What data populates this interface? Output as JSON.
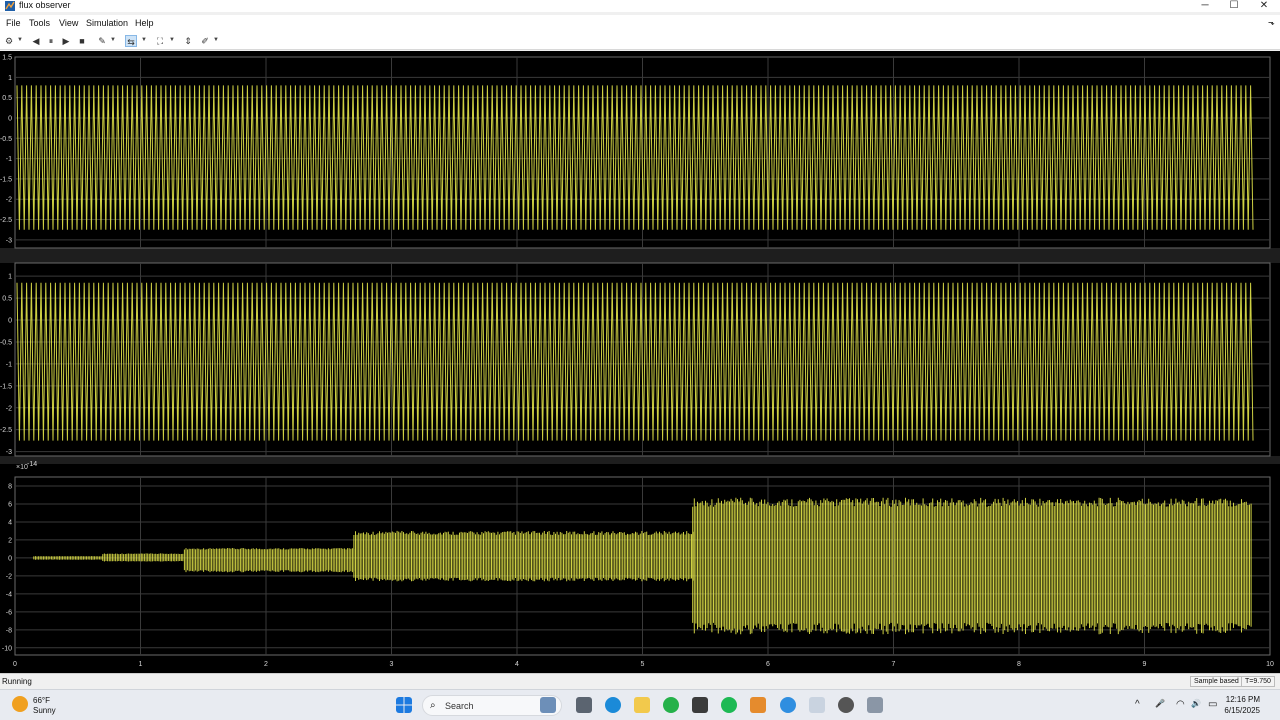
{
  "window": {
    "title": "flux observer"
  },
  "window_controls": {
    "minimize": "─",
    "maximize": "☐",
    "close": "✕"
  },
  "menu": {
    "items": [
      "File",
      "Tools",
      "View",
      "Simulation",
      "Help"
    ],
    "overflow": "⬎"
  },
  "toolbar": {
    "settings_icon": "⚙",
    "step_back_icon": "◀",
    "pause_icon": "⏸",
    "play_icon": "▶",
    "stop_icon": "■",
    "highlight_icon": "✎",
    "cursor_icon": "⇆",
    "zoom_icon": "⛶",
    "autoscale_icon": "⇕",
    "style_icon": "✐",
    "dropdown": "▼"
  },
  "plots": [
    {
      "y_ticks": [
        "1.5",
        "1",
        "0.5",
        "0",
        "-0.5",
        "-1",
        "-1.5",
        "-2",
        "-2.5",
        "-3"
      ]
    },
    {
      "y_ticks": [
        "1",
        "0.5",
        "0",
        "-0.5",
        "-1",
        "-1.5",
        "-2",
        "-2.5",
        "-3"
      ]
    },
    {
      "exponent": "×10",
      "exponent_power": "-14",
      "y_ticks": [
        "8",
        "6",
        "4",
        "2",
        "0",
        "-2",
        "-4",
        "-6",
        "-8",
        "-10"
      ]
    }
  ],
  "x_ticks": [
    "0",
    "1",
    "2",
    "3",
    "4",
    "5",
    "6",
    "7",
    "8",
    "9",
    "10"
  ],
  "chart_data": [
    {
      "type": "line",
      "title": "",
      "xlabel": "",
      "ylabel": "",
      "xlim": [
        0,
        10
      ],
      "ylim": [
        -3.2,
        1.5
      ],
      "series": [
        {
          "color": "#e6e84a",
          "y_range": [
            -2.75,
            0.8
          ],
          "x_range": [
            0,
            9.85
          ]
        }
      ]
    },
    {
      "type": "line",
      "title": "",
      "xlabel": "",
      "ylabel": "",
      "xlim": [
        0,
        10
      ],
      "ylim": [
        -3.1,
        1.3
      ],
      "series": [
        {
          "color": "#e6e84a",
          "y_range": [
            -2.75,
            0.85
          ],
          "x_range": [
            0,
            9.85
          ]
        }
      ]
    },
    {
      "type": "line",
      "title": "",
      "xlabel": "",
      "ylabel": "",
      "xlim": [
        0,
        10
      ],
      "ylim": [
        -10.8,
        9
      ],
      "y_scale": "1e-14",
      "series": [
        {
          "color": "#e6e84a",
          "envelope_segments": [
            {
              "x": [
                0.15,
                0.7
              ],
              "ymin": -0.2,
              "ymax": 0.2
            },
            {
              "x": [
                0.7,
                1.35
              ],
              "ymin": -0.4,
              "ymax": 0.5
            },
            {
              "x": [
                1.35,
                2.7
              ],
              "ymin": -1.6,
              "ymax": 1.1
            },
            {
              "x": [
                2.7,
                5.4
              ],
              "ymin": -2.6,
              "ymax": 3.0
            },
            {
              "x": [
                5.4,
                9.85
              ],
              "ymin": -8.5,
              "ymax": 6.7
            }
          ]
        }
      ]
    }
  ],
  "status": {
    "text": "Running",
    "mode": "Sample based",
    "time": "T=9.750"
  },
  "taskbar": {
    "weather_temp": "66°F",
    "weather_cond": "Sunny",
    "search_placeholder": "Search",
    "search_icon": "⌕",
    "chevron_icon": "^",
    "mic_icon": "🎤",
    "wifi_icon": "◠",
    "volume_icon": "🔊",
    "battery_icon": "▭",
    "time": "12:16 PM",
    "date": "6/15/2025"
  },
  "colors": {
    "signal": "#e6e84a",
    "plot_bg": "#000000",
    "grid": "#3a3a3a"
  }
}
